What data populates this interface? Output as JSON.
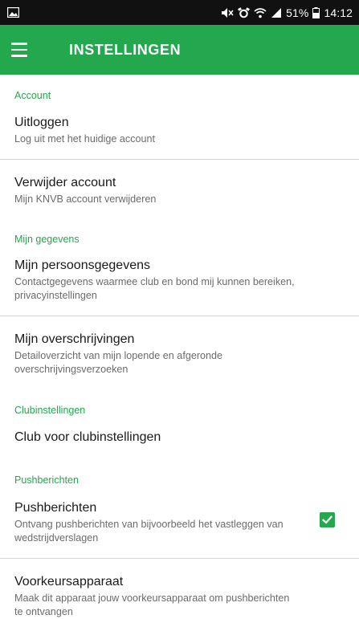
{
  "status_bar": {
    "battery_percent": "51%",
    "time": "14:12"
  },
  "app_bar": {
    "title": "INSTELLINGEN"
  },
  "sections": [
    {
      "header": "Account",
      "items": [
        {
          "title": "Uitloggen",
          "subtitle": "Log uit met het huidige account"
        },
        {
          "title": "Verwijder account",
          "subtitle": "Mijn KNVB account verwijderen"
        }
      ]
    },
    {
      "header": "Mijn gegevens",
      "items": [
        {
          "title": "Mijn persoonsgegevens",
          "subtitle": "Contactgegevens waarmee club en bond mij kunnen bereiken, privacyinstellingen"
        },
        {
          "title": "Mijn overschrijvingen",
          "subtitle": "Detailoverzicht van mijn lopende en afgeronde overschrijvingsverzoeken"
        }
      ]
    },
    {
      "header": "Clubinstellingen",
      "items": [
        {
          "title": "Club voor clubinstellingen"
        }
      ]
    },
    {
      "header": "Pushberichten",
      "items": [
        {
          "title": "Pushberichten",
          "subtitle": "Ontvang pushberichten van bijvoorbeeld het vastleggen van wedstrijdverslagen",
          "checked": true
        },
        {
          "title": "Voorkeursapparaat",
          "subtitle": "Maak dit apparaat jouw voorkeursapparaat om pushberichten te ontvangen"
        }
      ]
    }
  ],
  "colors": {
    "brand_green": "#23a84d",
    "status_bar": "#111111"
  },
  "icons": {
    "status_left": "image-notification-icon",
    "menu": "hamburger-menu-icon",
    "checkbox": "check-icon"
  }
}
